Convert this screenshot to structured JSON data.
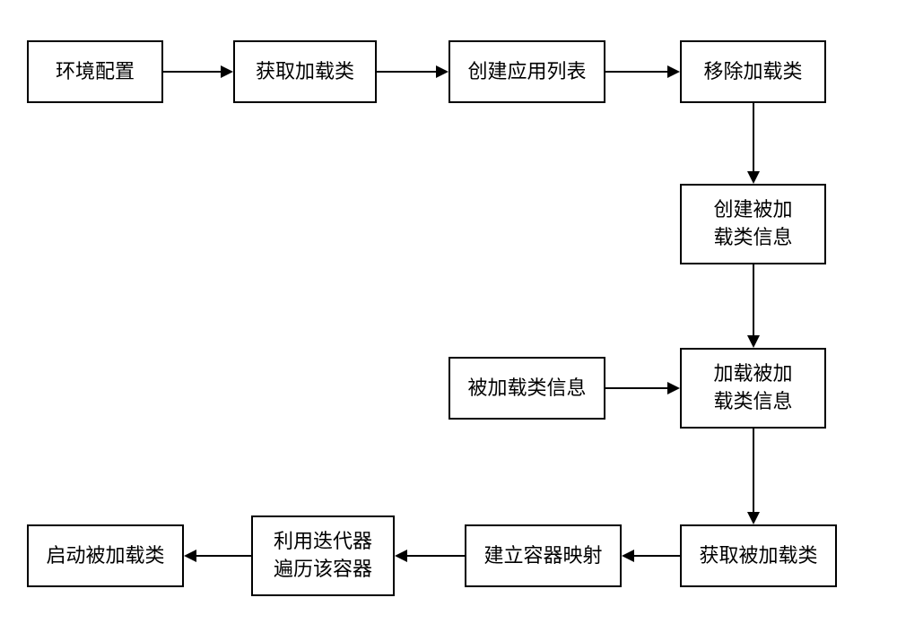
{
  "chart_data": {
    "type": "flowchart",
    "nodes": [
      {
        "id": "n1",
        "label": "环境配置"
      },
      {
        "id": "n2",
        "label": "获取加载类"
      },
      {
        "id": "n3",
        "label": "创建应用列表"
      },
      {
        "id": "n4",
        "label": "移除加载类"
      },
      {
        "id": "n5",
        "label": "创建被加\n载类信息"
      },
      {
        "id": "n6",
        "label": "被加载类信息"
      },
      {
        "id": "n7",
        "label": "加载被加\n载类信息"
      },
      {
        "id": "n8",
        "label": "获取被加载类"
      },
      {
        "id": "n9",
        "label": "建立容器映射"
      },
      {
        "id": "n10",
        "label": "利用迭代器\n遍历该容器"
      },
      {
        "id": "n11",
        "label": "启动被加载类"
      }
    ],
    "edges": [
      {
        "from": "n1",
        "to": "n2"
      },
      {
        "from": "n2",
        "to": "n3"
      },
      {
        "from": "n3",
        "to": "n4"
      },
      {
        "from": "n4",
        "to": "n5"
      },
      {
        "from": "n5",
        "to": "n7"
      },
      {
        "from": "n6",
        "to": "n7"
      },
      {
        "from": "n7",
        "to": "n8"
      },
      {
        "from": "n8",
        "to": "n9"
      },
      {
        "from": "n9",
        "to": "n10"
      },
      {
        "from": "n10",
        "to": "n11"
      }
    ]
  },
  "nodes": {
    "n1": "环境配置",
    "n2": "获取加载类",
    "n3": "创建应用列表",
    "n4": "移除加载类",
    "n5_l1": "创建被加",
    "n5_l2": "载类信息",
    "n6": "被加载类信息",
    "n7_l1": "加载被加",
    "n7_l2": "载类信息",
    "n8": "获取被加载类",
    "n9": "建立容器映射",
    "n10_l1": "利用迭代器",
    "n10_l2": "遍历该容器",
    "n11": "启动被加载类"
  }
}
